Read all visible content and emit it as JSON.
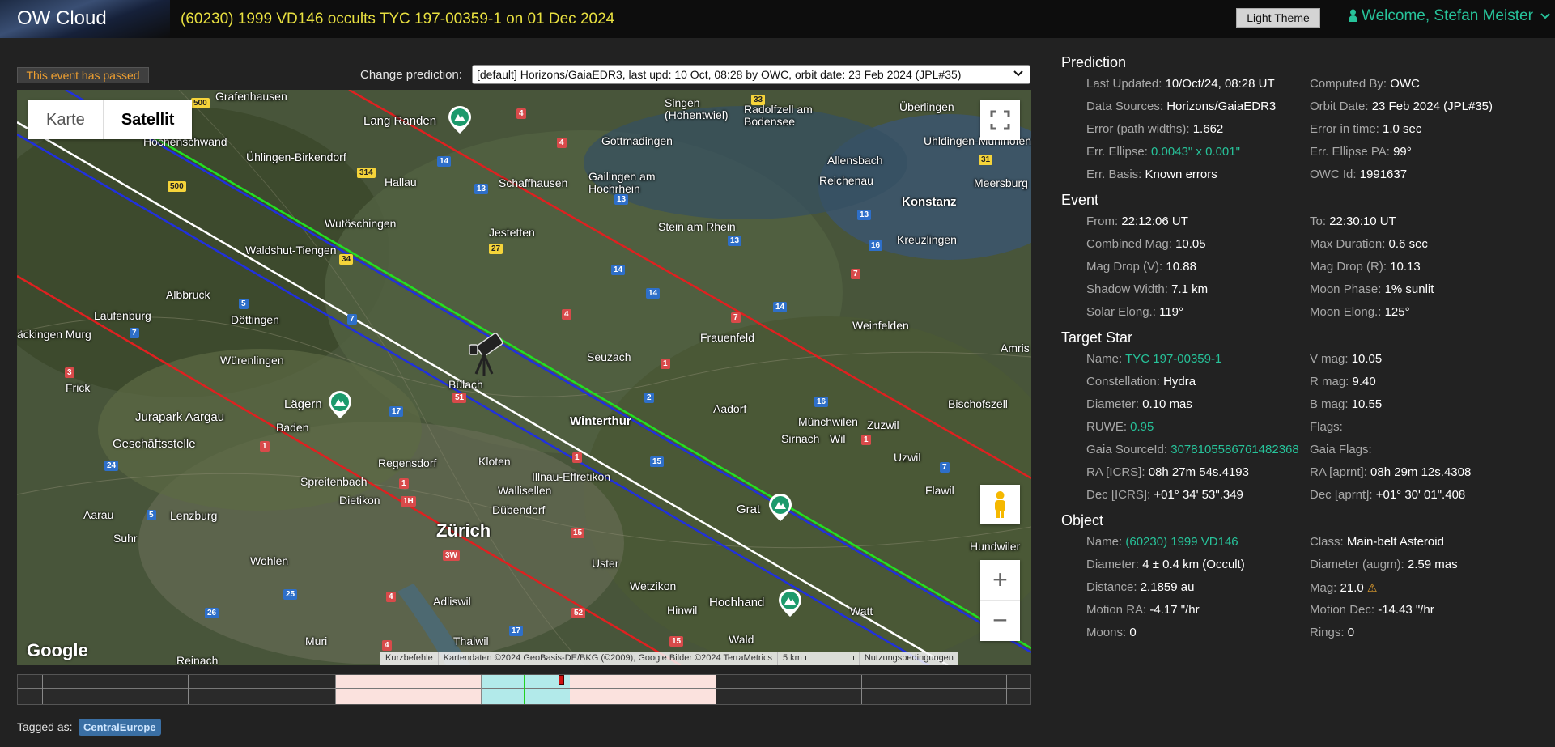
{
  "header": {
    "brand": "OW Cloud",
    "title": "(60230) 1999 VD146 occults TYC 197-00359-1 on 01 Dec 2024",
    "theme_button": "Light Theme",
    "welcome": "Welcome, Stefan Meister"
  },
  "event_status": "This event has passed",
  "prediction_select": {
    "label": "Change prediction:",
    "value": "[default] Horizons/GaiaEDR3, last upd: 10 Oct, 08:28 by OWC, orbit date: 23 Feb 2024 (JPL#35)"
  },
  "map": {
    "type_buttons": [
      "Karte",
      "Satellit"
    ],
    "active_type": "Satellit",
    "zoom_in": "+",
    "zoom_out": "−",
    "logo": "Google",
    "attribution": {
      "shortcuts": "Kurzbefehle",
      "data": "Kartendaten ©2024 GeoBasis-DE/BKG (©2009), Google Bilder ©2024 TerraMetrics",
      "scale": "5 km",
      "terms": "Nutzungsbedingungen"
    },
    "places": {
      "zurich": "Zürich",
      "winterthur": "Winterthur",
      "schaffhausen": "Schaffhausen",
      "konstanz": "Konstanz",
      "frauenfeld": "Frauenfeld",
      "baden": "Baden",
      "aarau": "Aarau",
      "lenzburg": "Lenzburg",
      "kloten": "Kloten",
      "bulach": "Bülach",
      "uster": "Uster",
      "wetzikon": "Wetzikon",
      "hinwil": "Hinwil",
      "dubendorf": "Dübendorf",
      "wallisellen": "Wallisellen",
      "illnau": "Illnau-Effretikon",
      "regensdorf": "Regensdorf",
      "dietikon": "Dietikon",
      "spreitenbach": "Spreitenbach",
      "seuzach": "Seuzach",
      "aadorf": "Aadorf",
      "wil": "Wil",
      "uzwil": "Uzwil",
      "flawil": "Flawil",
      "weinfelden": "Weinfelden",
      "amriswil": "Amris",
      "bischofszell": "Bischofszell",
      "munchwilen": "Münchwilen",
      "sirnach": "Sirnach",
      "zuzwil": "Zuzwil",
      "kreuzlingen": "Kreuzlingen",
      "steinamrhein": "Stein am Rhein",
      "jestetten": "Jestetten",
      "gailingen": "Gailingen am Hochrhein",
      "gottmadingen": "Gottmadingen",
      "singen": "Singen (Hohentwiel)",
      "radolfzell": "Radolfzell am Bodensee",
      "allensbach": "Allensbach",
      "reichenau": "Reichenau",
      "uberlingen": "Überlingen",
      "uhldingen": "Uhldingen-Mühlhofen",
      "meersburg": "Meersburg",
      "grafenhausen": "Grafenhausen",
      "hochenschwand": "Höchenschwand",
      "uhlingen": "Ühlingen-Birkendorf",
      "hallau": "Hallau",
      "wutoschingen": "Wutöschingen",
      "waldshut": "Waldshut-Tiengen",
      "albbruck": "Albbruck",
      "laufenburg": "Laufenburg",
      "sackingen": "äckingen Murg",
      "dottingen": "Döttingen",
      "wurenlingen": "Würenlingen",
      "frick": "Frick",
      "jurapark": "Jurapark Aargau",
      "geschaftsstelle": "Geschäftsstelle",
      "lagern": "Lägern",
      "langranden": "Lang Randen",
      "suhr": "Suhr",
      "wohlen": "Wohlen",
      "muri": "Muri",
      "reinach": "Reinach",
      "adliswil": "Adliswil",
      "thalwil": "Thalwil",
      "wald": "Wald",
      "hochhand": "Hochhand",
      "grat": "Grat",
      "hundwiler": "Hundwiler",
      "watt": "Watt"
    }
  },
  "tagged": {
    "label": "Tagged as:",
    "tag": "CentralEurope"
  },
  "prediction": {
    "title": "Prediction",
    "rows": [
      [
        {
          "label": "Last Updated:",
          "value": "10/Oct/24, 08:28 UT"
        },
        {
          "label": "Computed By:",
          "value": "OWC"
        }
      ],
      [
        {
          "label": "Data Sources:",
          "value": "Horizons/GaiaEDR3"
        },
        {
          "label": "Orbit Date:",
          "value": "23 Feb 2024 (JPL#35)"
        }
      ],
      [
        {
          "label": "Error (path widths):",
          "value": "1.662"
        },
        {
          "label": "Error in time:",
          "value": "1.0 sec"
        }
      ],
      [
        {
          "label": "Err. Ellipse:",
          "value": "0.0043\" x 0.001\""
        },
        {
          "label": "Err. Ellipse PA:",
          "value": "99°"
        }
      ],
      [
        {
          "label": "Err. Basis:",
          "value": "Known errors"
        },
        {
          "label": "OWC Id:",
          "value": "1991637"
        }
      ]
    ]
  },
  "event": {
    "title": "Event",
    "rows": [
      [
        {
          "label": "From:",
          "value": "22:12:06 UT"
        },
        {
          "label": "To:",
          "value": "22:30:10 UT"
        }
      ],
      [
        {
          "label": "Combined Mag:",
          "value": "10.05"
        },
        {
          "label": "Max Duration:",
          "value": "0.6 sec"
        }
      ],
      [
        {
          "label": "Mag Drop (V):",
          "value": "10.88"
        },
        {
          "label": "Mag Drop (R):",
          "value": "10.13"
        }
      ],
      [
        {
          "label": "Shadow Width:",
          "value": "7.1 km"
        },
        {
          "label": "Moon Phase:",
          "value": "1% sunlit"
        }
      ],
      [
        {
          "label": "Solar Elong.:",
          "value": "119°"
        },
        {
          "label": "Moon Elong.:",
          "value": "125°"
        }
      ]
    ]
  },
  "target_star": {
    "title": "Target Star",
    "rows": [
      [
        {
          "label": "Name:",
          "value": "TYC 197-00359-1"
        },
        {
          "label": "V mag:",
          "value": "10.05"
        }
      ],
      [
        {
          "label": "Constellation:",
          "value": "Hydra"
        },
        {
          "label": "R mag:",
          "value": "9.40"
        }
      ],
      [
        {
          "label": "Diameter:",
          "value": "0.10 mas"
        },
        {
          "label": "B mag:",
          "value": "10.55"
        }
      ],
      [
        {
          "label": "RUWE:",
          "value": "0.95"
        },
        {
          "label": "Flags:",
          "value": ""
        }
      ],
      [
        {
          "label": "Gaia SourceId:",
          "value": "3078105586761482368"
        },
        {
          "label": "Gaia Flags:",
          "value": ""
        }
      ],
      [
        {
          "label": "RA [ICRS]:",
          "value": "08h 27m 54s.4193"
        },
        {
          "label": "RA [aprnt]:",
          "value": "08h 29m 12s.4308"
        }
      ],
      [
        {
          "label": "Dec [ICRS]:",
          "value": "+01° 34' 53\".349"
        },
        {
          "label": "Dec [aprnt]:",
          "value": "+01° 30' 01\".408"
        }
      ]
    ]
  },
  "object": {
    "title": "Object",
    "rows": [
      [
        {
          "label": "Name:",
          "value": "(60230) 1999 VD146"
        },
        {
          "label": "Class:",
          "value": "Main-belt Asteroid"
        }
      ],
      [
        {
          "label": "Diameter:",
          "value": "4 ± 0.4 km (Occult)"
        },
        {
          "label": "Diameter (augm):",
          "value": "2.59 mas"
        }
      ],
      [
        {
          "label": "Distance:",
          "value": "2.1859 au"
        },
        {
          "label": "Mag:",
          "value": "21.0"
        }
      ],
      [
        {
          "label": "Motion RA:",
          "value": "-4.17 \"/hr"
        },
        {
          "label": "Motion Dec:",
          "value": "-14.43 \"/hr"
        }
      ],
      [
        {
          "label": "Moons:",
          "value": "0"
        },
        {
          "label": "Rings:",
          "value": "0"
        }
      ]
    ]
  },
  "colors": {
    "accent": "#27c39a",
    "title_yellow": "#e8e040",
    "warning": "#f0a030",
    "path_center": "#ffffff",
    "path_shadow": "#22e022",
    "path_sigma": "#2030e0",
    "path_outer": "#e02020"
  },
  "icons": [
    "user-icon",
    "chevron-down-icon",
    "fullscreen-icon",
    "pegman-icon",
    "telescope-icon",
    "mountain-marker-icon",
    "warning-icon"
  ]
}
